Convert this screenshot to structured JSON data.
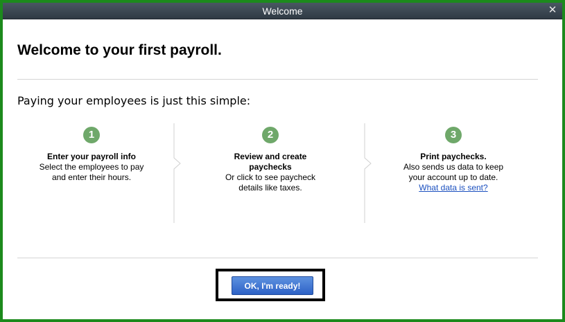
{
  "window": {
    "title": "Welcome",
    "close_icon": "close-icon"
  },
  "heading": "Welcome to your first payroll.",
  "intro": "Paying your employees is just this simple:",
  "steps": [
    {
      "number": "1",
      "title": "Enter your payroll info",
      "lines": [
        "Select the employees to pay",
        "and enter their hours."
      ]
    },
    {
      "number": "2",
      "title_lines": [
        "Review and create",
        "paychecks"
      ],
      "lines": [
        "Or click to see paycheck",
        "details like taxes."
      ]
    },
    {
      "number": "3",
      "title": "Print paychecks.",
      "lines": [
        "Also sends us data to keep",
        "your account up to date."
      ],
      "link": "What data is sent?"
    }
  ],
  "ok_button": "OK, I'm ready!",
  "colors": {
    "frame_border": "#1c8a1c",
    "step_circle": "#6fa86a",
    "button": "#3a6fd0",
    "link": "#1a4fbf"
  }
}
